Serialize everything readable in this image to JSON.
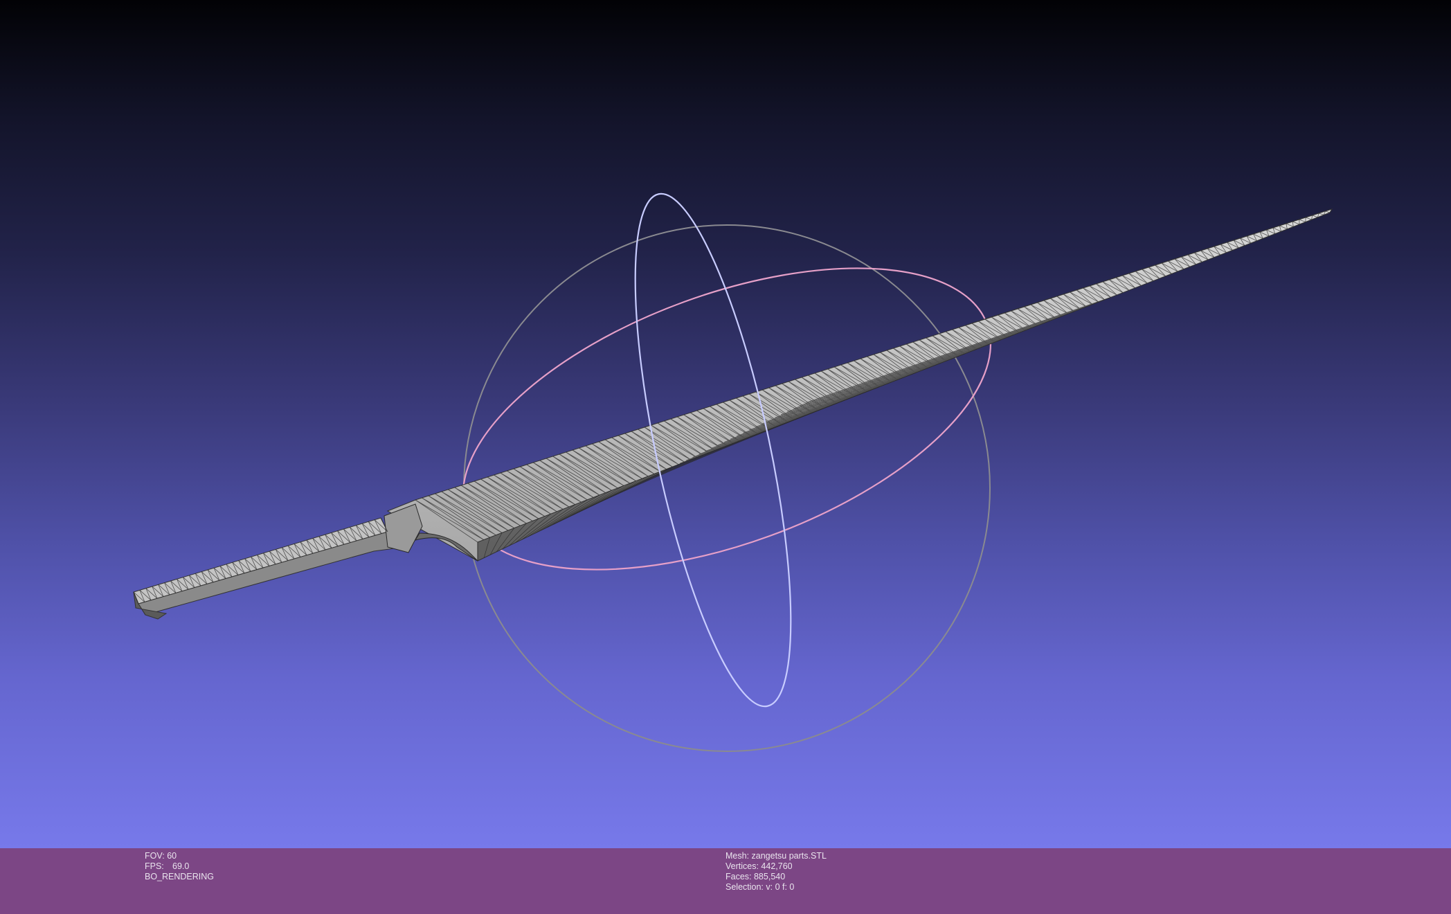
{
  "viewport": {
    "object": "mesh",
    "trackball": "trackball"
  },
  "status_left": {
    "fov_label": "FOV:",
    "fov_value": "60",
    "fps_label": "FPS:",
    "fps_value": "69.0",
    "mode": "BO_RENDERING"
  },
  "status_right": {
    "mesh": "Mesh: zangetsu parts.STL",
    "vertices": "Vertices: 442,760",
    "faces": "Faces: 885,540",
    "selection": "Selection: v: 0 f: 0"
  },
  "colors": {
    "background_top": "#020205",
    "background_bottom": "#7779ea",
    "status_bar": "#7c4685",
    "mesh_fill": "#9c9c9c",
    "wire": "#2a2a2a",
    "trackball_ring": "#8a8a90",
    "trackball_vertical": "#c8ccff",
    "trackball_horizontal": "#e6a0c8"
  }
}
